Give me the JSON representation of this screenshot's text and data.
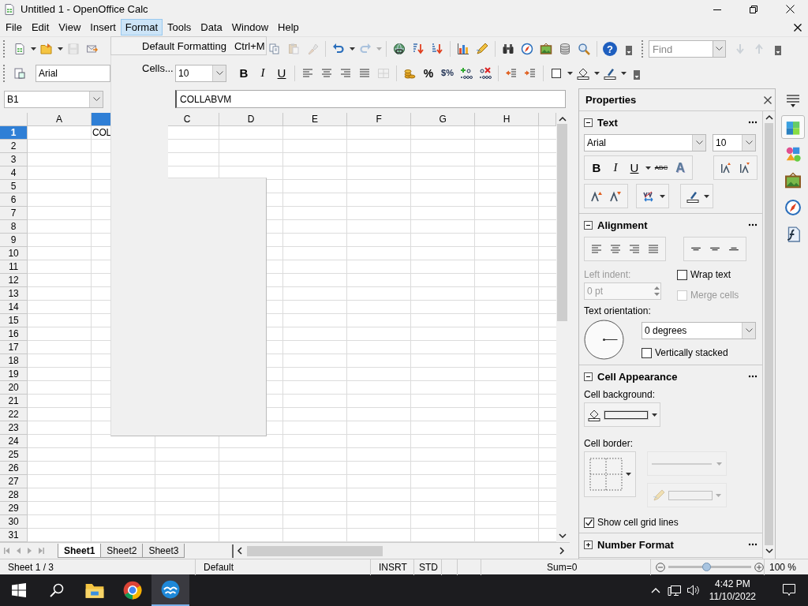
{
  "window": {
    "title": "Untitled 1 - OpenOffice Calc"
  },
  "menubar": {
    "items": [
      {
        "label": "File",
        "selected": false
      },
      {
        "label": "Edit",
        "selected": false
      },
      {
        "label": "View",
        "selected": false
      },
      {
        "label": "Insert",
        "selected": false
      },
      {
        "label": "Format",
        "selected": true
      },
      {
        "label": "Tools",
        "selected": false
      },
      {
        "label": "Data",
        "selected": false
      },
      {
        "label": "Window",
        "selected": false
      },
      {
        "label": "Help",
        "selected": false
      }
    ]
  },
  "format_menu": {
    "items": [
      {
        "label": "Default Formatting",
        "shortcut": "Ctrl+M"
      },
      {
        "label": "Cells..."
      }
    ]
  },
  "standard_toolbar": {
    "items": [
      {
        "kind": "new",
        "dropdown": true,
        "disabled": false
      },
      {
        "kind": "open",
        "dropdown": true,
        "disabled": false
      },
      {
        "kind": "save",
        "disabled": true
      },
      {
        "kind": "email",
        "disabled": false
      }
    ],
    "items_after_menu": [
      {
        "kind": "copy",
        "disabled": false
      },
      {
        "kind": "paste",
        "disabled": true
      },
      {
        "kind": "clone",
        "disabled": true
      },
      {
        "kind": "separator"
      },
      {
        "kind": "undo",
        "dropdown": true,
        "disabled": false
      },
      {
        "kind": "redo",
        "dropdown": true,
        "disabled": true
      },
      {
        "kind": "separator"
      },
      {
        "kind": "hyperlink",
        "disabled": false
      },
      {
        "kind": "sort-ascending",
        "disabled": false
      },
      {
        "kind": "sort-descending",
        "disabled": false
      },
      {
        "kind": "separator"
      },
      {
        "kind": "chart",
        "disabled": false
      },
      {
        "kind": "draw",
        "disabled": false
      },
      {
        "kind": "separator"
      },
      {
        "kind": "find-replace",
        "disabled": false
      },
      {
        "kind": "navigator",
        "disabled": false
      },
      {
        "kind": "gallery",
        "disabled": false
      },
      {
        "kind": "data-sources",
        "disabled": false
      },
      {
        "kind": "zoom",
        "disabled": false
      },
      {
        "kind": "separator"
      },
      {
        "kind": "help",
        "label": "?",
        "disabled": false
      },
      {
        "kind": "overflow",
        "disabled": false
      }
    ]
  },
  "find_toolbar": {
    "placeholder": "Find",
    "buttons": [
      {
        "kind": "find-next",
        "disabled": true
      },
      {
        "kind": "find-previous",
        "disabled": true
      },
      {
        "kind": "overflow",
        "disabled": false
      }
    ]
  },
  "formatting_toolbar": {
    "font_name": "Arial",
    "font_size": "10",
    "items": [
      {
        "kind": "bold",
        "label": "B",
        "disabled": false
      },
      {
        "kind": "italic",
        "label": "I",
        "disabled": false
      },
      {
        "kind": "underline",
        "label": "U",
        "disabled": false
      },
      {
        "kind": "separator"
      },
      {
        "kind": "align-left",
        "disabled": false
      },
      {
        "kind": "align-center",
        "disabled": false
      },
      {
        "kind": "align-right",
        "disabled": false
      },
      {
        "kind": "justify",
        "disabled": false
      },
      {
        "kind": "merge",
        "disabled": true
      },
      {
        "kind": "separator"
      },
      {
        "kind": "currency",
        "disabled": false
      },
      {
        "kind": "percent",
        "label": "%",
        "disabled": false
      },
      {
        "kind": "standard",
        "label": "$%",
        "disabled": false
      },
      {
        "kind": "add-decimal",
        "disabled": false
      },
      {
        "kind": "delete-decimal",
        "disabled": false
      },
      {
        "kind": "separator"
      },
      {
        "kind": "decrease-indent",
        "disabled": false
      },
      {
        "kind": "increase-indent",
        "disabled": false
      },
      {
        "kind": "separator"
      },
      {
        "kind": "borders",
        "dropdown": true,
        "disabled": false
      },
      {
        "kind": "background-color",
        "dropdown": true,
        "disabled": false
      },
      {
        "kind": "font-color",
        "dropdown": true,
        "disabled": false
      },
      {
        "kind": "overflow",
        "disabled": false
      }
    ]
  },
  "formula_bar": {
    "name_box": "B1",
    "content": "COLLABVM"
  },
  "sheet": {
    "columns": [
      {
        "label": "A",
        "selected": false
      },
      {
        "selected": true
      },
      {
        "label": "C",
        "selected": false
      },
      {
        "label": "D",
        "selected": false
      },
      {
        "label": "E",
        "selected": false
      },
      {
        "label": "F",
        "selected": false
      },
      {
        "label": "G",
        "selected": false
      },
      {
        "label": "H",
        "selected": false
      }
    ],
    "rows": [
      {
        "label": "1",
        "selected": true,
        "cells": [
          {
            "kind": "empty"
          },
          {
            "kind": "text",
            "text": "COL"
          }
        ]
      },
      {
        "label": "2",
        "selected": false
      },
      {
        "label": "3",
        "selected": false
      },
      {
        "label": "4",
        "selected": false
      },
      {
        "label": "5",
        "selected": false
      },
      {
        "label": "6",
        "selected": false
      },
      {
        "label": "7",
        "selected": false
      },
      {
        "label": "8",
        "selected": false
      },
      {
        "label": "9",
        "selected": false
      },
      {
        "label": "10",
        "selected": false
      },
      {
        "label": "11",
        "selected": false
      },
      {
        "label": "12",
        "selected": false
      },
      {
        "label": "13",
        "selected": false
      },
      {
        "label": "14",
        "selected": false
      },
      {
        "label": "15",
        "selected": false
      },
      {
        "label": "16",
        "selected": false
      },
      {
        "label": "17",
        "selected": false
      },
      {
        "label": "18",
        "selected": false
      },
      {
        "label": "19",
        "selected": false
      },
      {
        "label": "20",
        "selected": false
      },
      {
        "label": "21",
        "selected": false
      },
      {
        "label": "22",
        "selected": false
      },
      {
        "label": "23",
        "selected": false
      },
      {
        "label": "24",
        "selected": false
      },
      {
        "label": "25",
        "selected": false
      },
      {
        "label": "26",
        "selected": false
      },
      {
        "label": "27",
        "selected": false
      },
      {
        "label": "28",
        "selected": false
      },
      {
        "label": "29",
        "selected": false
      },
      {
        "label": "30",
        "selected": false
      },
      {
        "label": "31",
        "selected": false
      }
    ]
  },
  "sheet_tabs": [
    {
      "label": "Sheet1",
      "selected": true
    },
    {
      "label": "Sheet2",
      "selected": false
    },
    {
      "label": "Sheet3",
      "selected": false
    }
  ],
  "sidebar": {
    "title": "Properties",
    "text_section": {
      "title": "Text",
      "expanded": true,
      "font_name": "Arial",
      "font_size": "10",
      "styles": [
        {
          "kind": "bold",
          "label": "B"
        },
        {
          "kind": "italic",
          "label": "I"
        },
        {
          "kind": "underline",
          "label": "U"
        },
        {
          "kind": "strikethrough",
          "label": "ABC"
        },
        {
          "kind": "shadow",
          "label": "A"
        }
      ]
    },
    "alignment_section": {
      "title": "Alignment",
      "expanded": true,
      "left_indent_label": "Left indent:",
      "left_indent": {
        "value": "0 pt",
        "disabled": true
      },
      "wrap_text": {
        "label": "Wrap text",
        "checked": false,
        "disabled": false
      },
      "merge_cells": {
        "label": "Merge cells",
        "checked": false,
        "disabled": true
      },
      "orientation_label": "Text orientation:",
      "orientation": "0 degrees",
      "vertically_stacked": {
        "label": "Vertically stacked",
        "checked": false,
        "disabled": false
      }
    },
    "appearance_section": {
      "title": "Cell Appearance",
      "expanded": true,
      "background_label": "Cell background:",
      "border_label": "Cell border:",
      "line_style_disabled": true,
      "line_color_disabled": true,
      "grid_lines": {
        "label": "Show cell grid lines",
        "checked": true,
        "disabled": false
      }
    },
    "number_section": {
      "title": "Number Format",
      "expanded": false
    }
  },
  "deck_tabs": [
    {
      "kind": "properties",
      "selected": true
    },
    {
      "kind": "styles",
      "selected": false
    },
    {
      "kind": "gallery",
      "selected": false
    },
    {
      "kind": "navigator",
      "selected": false
    },
    {
      "kind": "functions",
      "selected": false
    }
  ],
  "status_bar": {
    "sheet": "Sheet 1 / 3",
    "page_style": "Default",
    "insert_mode": "INSRT",
    "selection_mode": "STD",
    "sum": "Sum=0",
    "zoom": {
      "level": 0.46,
      "reading": "100 %"
    }
  },
  "taskbar": {
    "apps": [
      {
        "kind": "file-explorer",
        "selected": false
      },
      {
        "kind": "browser",
        "selected": false
      },
      {
        "kind": "openoffice",
        "selected": true
      }
    ],
    "time": "4:42 PM",
    "date": "11/10/2022"
  }
}
